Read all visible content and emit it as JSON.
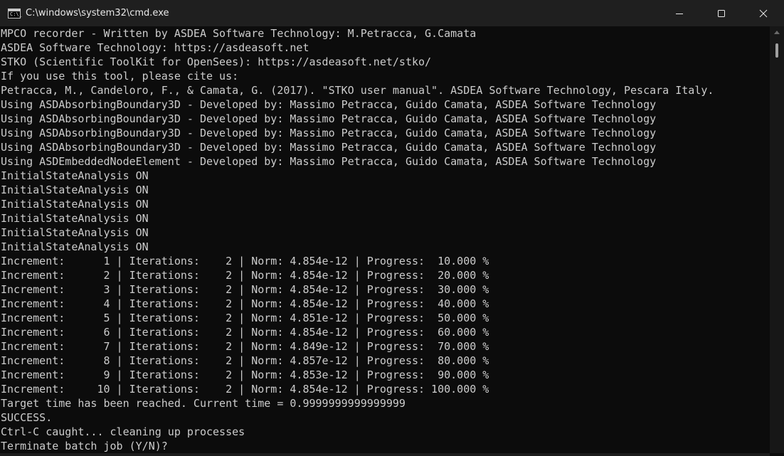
{
  "window": {
    "title": "C:\\windows\\system32\\cmd.exe",
    "icon": "cmd-icon",
    "icon_glyph": "C:\\_"
  },
  "console": {
    "lines": [
      "MPCO recorder - Written by ASDEA Software Technology: M.Petracca, G.Camata",
      "ASDEA Software Technology: https://asdeasoft.net",
      "STKO (Scientific ToolKit for OpenSees): https://asdeasoft.net/stko/",
      "If you use this tool, please cite us:",
      "Petracca, M., Candeloro, F., & Camata, G. (2017). \"STKO user manual\". ASDEA Software Technology, Pescara Italy.",
      "Using ASDAbsorbingBoundary3D - Developed by: Massimo Petracca, Guido Camata, ASDEA Software Technology",
      "Using ASDAbsorbingBoundary3D - Developed by: Massimo Petracca, Guido Camata, ASDEA Software Technology",
      "Using ASDAbsorbingBoundary3D - Developed by: Massimo Petracca, Guido Camata, ASDEA Software Technology",
      "Using ASDAbsorbingBoundary3D - Developed by: Massimo Petracca, Guido Camata, ASDEA Software Technology",
      "Using ASDEmbeddedNodeElement - Developed by: Massimo Petracca, Guido Camata, ASDEA Software Technology",
      "InitialStateAnalysis ON",
      "InitialStateAnalysis ON",
      "InitialStateAnalysis ON",
      "InitialStateAnalysis ON",
      "InitialStateAnalysis ON",
      "InitialStateAnalysis ON",
      "Increment:      1 | Iterations:    2 | Norm: 4.854e-12 | Progress:  10.000 %",
      "Increment:      2 | Iterations:    2 | Norm: 4.854e-12 | Progress:  20.000 %",
      "Increment:      3 | Iterations:    2 | Norm: 4.854e-12 | Progress:  30.000 %",
      "Increment:      4 | Iterations:    2 | Norm: 4.854e-12 | Progress:  40.000 %",
      "Increment:      5 | Iterations:    2 | Norm: 4.851e-12 | Progress:  50.000 %",
      "Increment:      6 | Iterations:    2 | Norm: 4.854e-12 | Progress:  60.000 %",
      "Increment:      7 | Iterations:    2 | Norm: 4.849e-12 | Progress:  70.000 %",
      "Increment:      8 | Iterations:    2 | Norm: 4.857e-12 | Progress:  80.000 %",
      "Increment:      9 | Iterations:    2 | Norm: 4.853e-12 | Progress:  90.000 %",
      "Increment:     10 | Iterations:    2 | Norm: 4.854e-12 | Progress: 100.000 %",
      "Target time has been reached. Current time = 0.9999999999999999",
      "SUCCESS.",
      "Ctrl-C caught... cleaning up processes",
      "Terminate batch job (Y/N)?"
    ]
  },
  "colors": {
    "console_bg": "#0c0c0c",
    "console_fg": "#cccccc",
    "titlebar_bg": "#1f1f1f",
    "titlebar_fg": "#e8e8e8"
  },
  "icons": {
    "minimize": "minimize-icon",
    "maximize": "maximize-icon",
    "close": "close-icon"
  }
}
